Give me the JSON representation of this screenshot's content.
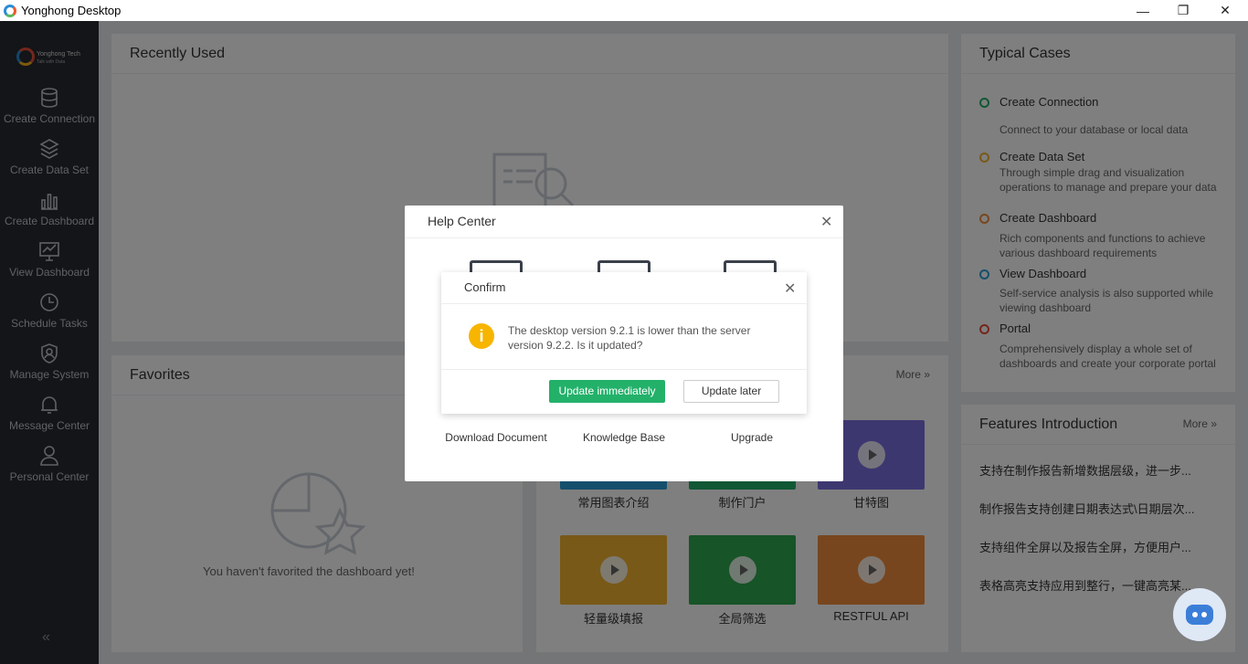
{
  "window": {
    "title": "Yonghong Desktop"
  },
  "sidebar": {
    "brand_name": "Yonghong Tech",
    "brand_slogan": "Talk with Data",
    "items": [
      {
        "label": "Create Connection",
        "icon": "database-icon"
      },
      {
        "label": "Create Data Set",
        "icon": "layers-icon"
      },
      {
        "label": "Create Dashboard",
        "icon": "bar-chart-icon"
      },
      {
        "label": "View Dashboard",
        "icon": "monitor-chart-icon"
      },
      {
        "label": "Schedule Tasks",
        "icon": "clock-icon"
      },
      {
        "label": "Manage System",
        "icon": "shield-user-icon"
      },
      {
        "label": "Message Center",
        "icon": "bell-icon"
      },
      {
        "label": "Personal Center",
        "icon": "user-icon"
      }
    ],
    "collapse_icon": "«"
  },
  "recent": {
    "title": "Recently Used"
  },
  "favorites": {
    "title": "Favorites",
    "empty": "You haven't favorited the dashboard yet!"
  },
  "videos": {
    "more": "More",
    "tiles": [
      {
        "label": "常用图表介绍",
        "color": "#2a9fd8"
      },
      {
        "label": "制作门户",
        "color": "#23b16a"
      },
      {
        "label": "甘特图",
        "color": "#7b6fe0"
      },
      {
        "label": "轻量级填报",
        "color": "#f2b330"
      },
      {
        "label": "全局筛选",
        "color": "#2fa84f"
      },
      {
        "label": "RESTFUL API",
        "color": "#f18d3c"
      }
    ]
  },
  "typical": {
    "title": "Typical Cases",
    "cases": [
      {
        "title": "Create Connection",
        "desc": "Connect to your database or local data",
        "color": "#23b16a"
      },
      {
        "title": "Create Data Set",
        "desc": "Through simple drag and visualization operations to manage and prepare your data",
        "color": "#f2b330"
      },
      {
        "title": "Create Dashboard",
        "desc": "Rich components and functions to achieve various dashboard requirements",
        "color": "#f18d3c"
      },
      {
        "title": "View Dashboard",
        "desc": "Self-service analysis is also supported while viewing dashboard",
        "color": "#2a9fd8"
      },
      {
        "title": "Portal",
        "desc": "Comprehensively display a whole set of dashboards and create your corporate portal",
        "color": "#e94e38"
      }
    ]
  },
  "features": {
    "title": "Features Introduction",
    "more": "More",
    "items": [
      "支持在制作报告新增数据层级，进一步...",
      "制作报告支持创建日期表达式\\日期层次...",
      "支持组件全屏以及报告全屏，方便用户...",
      "表格高亮支持应用到整行，一键高亮某..."
    ]
  },
  "help": {
    "title": "Help Center",
    "items": [
      "Download Document",
      "Knowledge Base",
      "Upgrade"
    ]
  },
  "confirm": {
    "title": "Confirm",
    "message": "The desktop version 9.2.1 is lower than the server version 9.2.2. Is it updated?",
    "primary": "Update immediately",
    "secondary": "Update later"
  }
}
